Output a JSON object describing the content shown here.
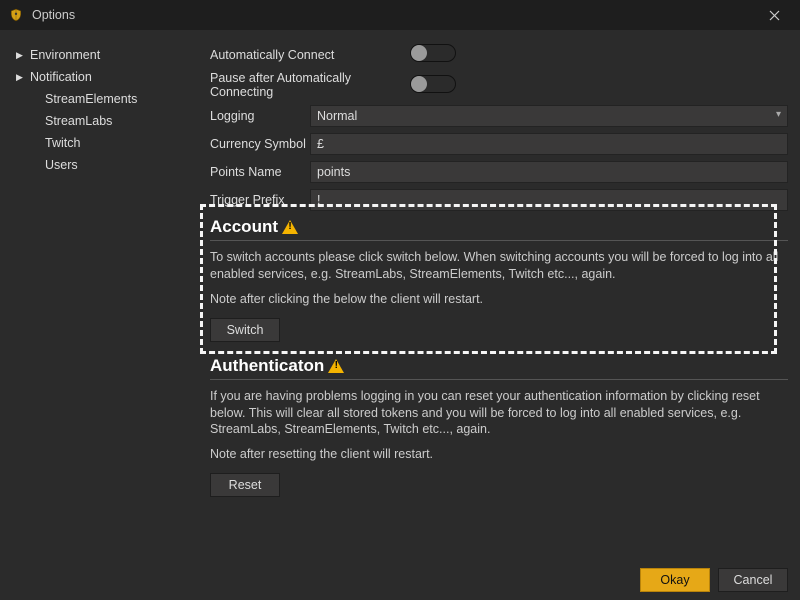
{
  "window": {
    "title": "Options"
  },
  "sidebar": {
    "items": [
      {
        "label": "Environment",
        "expandable": true
      },
      {
        "label": "Notification",
        "expandable": true
      },
      {
        "label": "StreamElements",
        "expandable": false
      },
      {
        "label": "StreamLabs",
        "expandable": false
      },
      {
        "label": "Twitch",
        "expandable": false
      },
      {
        "label": "Users",
        "expandable": false
      }
    ]
  },
  "settings": {
    "auto_connect_label": "Automatically Connect",
    "pause_label": "Pause after Automatically Connecting",
    "logging_label": "Logging",
    "logging_value": "Normal",
    "currency_label": "Currency Symbol",
    "currency_value": "£",
    "points_label": "Points Name",
    "points_value": "points",
    "trigger_label": "Trigger Prefix",
    "trigger_value": "!"
  },
  "account": {
    "title": "Account",
    "body1": "To switch accounts please click switch below. When switching accounts you will be forced to log into all enabled services, e.g. StreamLabs, StreamElements, Twitch etc..., again.",
    "body2": "Note after clicking the below the client will restart.",
    "switch_label": "Switch"
  },
  "auth": {
    "title": "Authenticaton",
    "body1": "If you are having problems logging in you can reset your authentication information by clicking reset below. This will clear all stored tokens and you will be forced to log into all enabled services, e.g. StreamLabs, StreamElements, Twitch etc..., again.",
    "body2": "Note after resetting the client will restart.",
    "reset_label": "Reset"
  },
  "footer": {
    "ok_label": "Okay",
    "cancel_label": "Cancel"
  }
}
